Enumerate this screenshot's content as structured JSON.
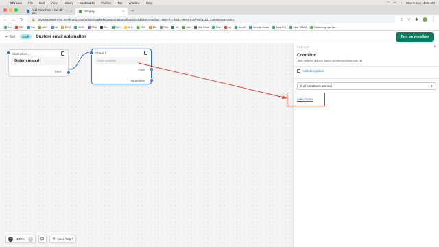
{
  "menubar": {
    "app": "Chrome",
    "items": [
      "File",
      "Edit",
      "View",
      "History",
      "Bookmarks",
      "Profiles",
      "Tab",
      "Window",
      "Help"
    ],
    "datetime": "Mon 5 Sep  11:31 AM"
  },
  "tabs": [
    {
      "label": "Add New Post ‹ Sendlf — Wo…"
    },
    {
      "label": "Shopify"
    }
  ],
  "address": {
    "url": "roctelepower-com.myshopify.com/admin/marketing/automations/flows/8154449047/editor?step=f7c-bb41-4e42-878f-04fa1121725969154449047"
  },
  "bookmarks": [
    "Em",
    "C87",
    "Cal",
    "ALC",
    "Ink",
    "BX.4",
    "SN G",
    "BRA",
    "Rm",
    "KUY",
    "DHL",
    "FDX",
    "BB",
    "SKp",
    "Inv",
    "Ads",
    "Wat Chat",
    "Moz",
    "LA",
    "Sendlf",
    "Weekly Goals",
    "Leaf List",
    "Leaf YAMM",
    "Measuring and ba…"
  ],
  "header": {
    "exit": "Exit",
    "draft": "Draft",
    "title": "Custom email automation",
    "turn_on": "Turn on workflow"
  },
  "canvas": {
    "trigger_header": "Start when…",
    "trigger_title": "Order created",
    "trigger_then": "Then",
    "cond_header": "Check if…",
    "cond_select": "Select condition",
    "cond_then": "Then",
    "cond_otherwise": "Otherwise"
  },
  "zoom": {
    "value": "100%",
    "help": "Need help?"
  },
  "panel": {
    "overline": "CHECK IF",
    "title": "Condition",
    "description": "Take different actions based on the conditions you set.",
    "add_description": "Add description",
    "select_value": "If all conditions are met",
    "add_criteria": "Add criteria"
  },
  "colors": {
    "accent": "#2c6ecb",
    "primary_button": "#008060",
    "annotation": "#e03b2a"
  }
}
